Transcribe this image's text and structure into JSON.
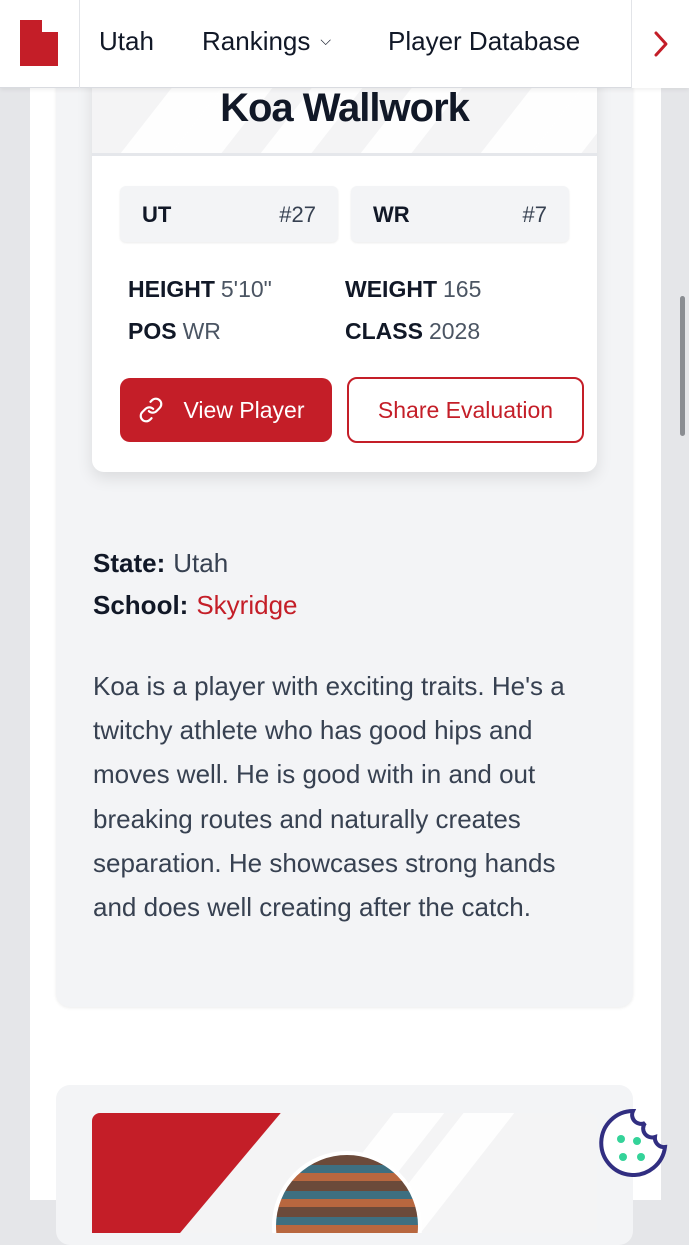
{
  "nav": {
    "items": [
      "Utah",
      "Rankings",
      "Player Database"
    ],
    "logo_icon": "utah-state-icon",
    "next_icon": "chevron-right-icon",
    "accent": "#c41e28"
  },
  "player": {
    "name": "Koa Wallwork",
    "state_rank": {
      "label": "UT",
      "value": "#27"
    },
    "position_rank": {
      "label": "WR",
      "value": "#7"
    },
    "stats": {
      "height_label": "HEIGHT",
      "height": "5'10\"",
      "weight_label": "WEIGHT",
      "weight": "165",
      "pos_label": "POS",
      "pos": "WR",
      "class_label": "CLASS",
      "class": "2028"
    },
    "buttons": {
      "view": "View Player",
      "share": "Share Evaluation"
    }
  },
  "details": {
    "state_label": "State:",
    "state": "Utah",
    "school_label": "School:",
    "school": "Skyridge"
  },
  "bio": "Koa is a player with exciting traits. He's a twitchy athlete who has good hips and moves well. He is good with in and out breaking routes and naturally creates separation. He showcases strong hands and does well creating after the catch."
}
